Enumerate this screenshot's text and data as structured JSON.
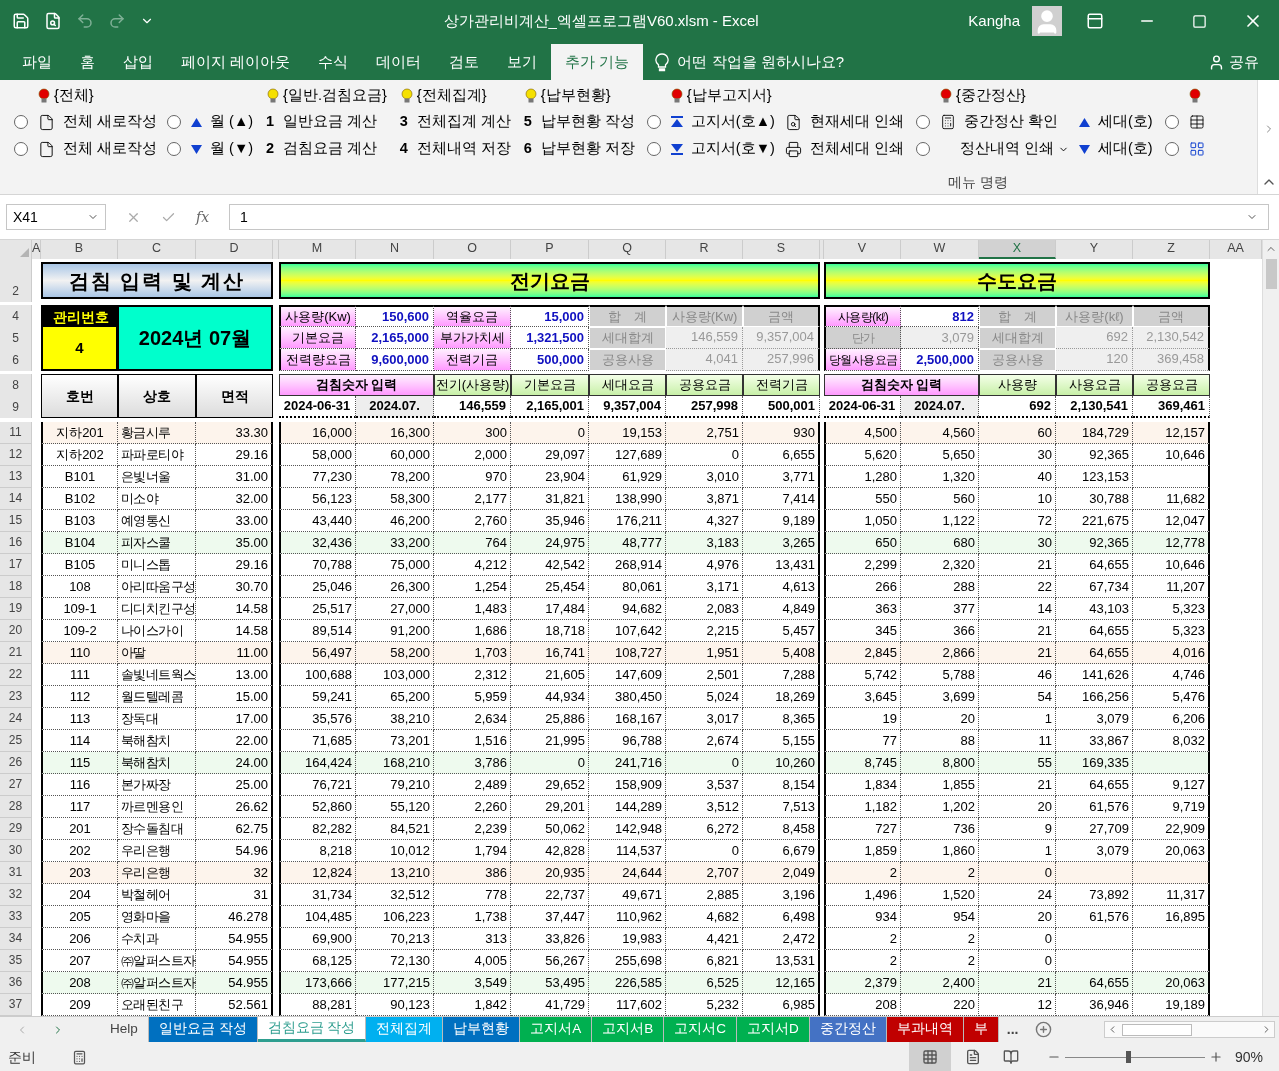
{
  "window": {
    "title": "상가관리비계산_엑셀프로그램V60.xlsm  -  Excel",
    "user": "Kangha"
  },
  "menu_tabs": [
    {
      "label": "파일",
      "selected": false
    },
    {
      "label": "홈",
      "selected": false
    },
    {
      "label": "삽입",
      "selected": false
    },
    {
      "label": "페이지 레이아웃",
      "selected": false
    },
    {
      "label": "수식",
      "selected": false
    },
    {
      "label": "데이터",
      "selected": false
    },
    {
      "label": "검토",
      "selected": false
    },
    {
      "label": "보기",
      "selected": false
    },
    {
      "label": "추가 기능",
      "selected": true
    }
  ],
  "tell_me": "어떤 작업을 원하시나요?",
  "share": "공유",
  "ribbon": {
    "group_label": "메뉴 명령",
    "sections": [
      {
        "header": {
          "label": "{전체}",
          "color": "#e00000"
        },
        "columns": [
          [
            {
              "kind": "radio",
              "selected": false
            },
            {
              "kind": "radio",
              "selected": false
            }
          ],
          [
            {
              "kind": "page",
              "text": "전체 새로작성"
            },
            {
              "kind": "page",
              "text": "전체 새로작성"
            }
          ],
          [
            {
              "kind": "radio",
              "selected": false
            },
            {
              "kind": "radio",
              "selected": false
            }
          ],
          [
            {
              "kind": "up",
              "text": "월 (▲)"
            },
            {
              "kind": "down",
              "text": "월 (▼)"
            }
          ]
        ]
      },
      {
        "header": {
          "label": "{일반.검침요금}",
          "color": "#f5e000"
        },
        "columns": [
          [
            {
              "kind": "number",
              "number": "1",
              "text": "일반요금 계산"
            },
            {
              "kind": "number",
              "number": "2",
              "text": "검침요금 계산"
            }
          ]
        ]
      },
      {
        "header": {
          "label": "{전체집계}",
          "color": "#f5e000"
        },
        "columns": [
          [
            {
              "kind": "number",
              "number": "3",
              "text": "전체집계 계산"
            },
            {
              "kind": "number",
              "number": "4",
              "text": "전체내역 저장"
            }
          ]
        ]
      },
      {
        "header": {
          "label": "{납부현황}",
          "color": "#f5e000"
        },
        "columns": [
          [
            {
              "kind": "number",
              "number": "5",
              "text": "납부현황 작성"
            },
            {
              "kind": "number",
              "number": "6",
              "text": "납부현황 저장"
            }
          ]
        ]
      },
      {
        "header": {
          "label": "{납부고지서}",
          "color": "#e00000"
        },
        "columns": [
          [
            {
              "kind": "radio",
              "selected": false
            },
            {
              "kind": "radio",
              "selected": false
            }
          ],
          [
            {
              "kind": "sortup",
              "text": "고지서(호▲)"
            },
            {
              "kind": "sortdown",
              "text": "고지서(호▼)"
            }
          ],
          [
            {
              "kind": "preview",
              "text": "현재세대 인쇄"
            },
            {
              "kind": "print",
              "text": "전체세대 인쇄"
            }
          ]
        ]
      },
      {
        "header": {
          "label": "{중간정산}",
          "color": "#e00000"
        },
        "columns": [
          [
            {
              "kind": "radio",
              "selected": false
            },
            {
              "kind": "radio",
              "selected": false
            }
          ],
          [
            {
              "kind": "calc",
              "text": "중간정산 확인"
            },
            {
              "kind": "menu",
              "text": "정산내역 인쇄"
            }
          ],
          [
            {
              "kind": "up",
              "text": "세대(호)"
            },
            {
              "kind": "down",
              "text": "세대(호)"
            }
          ]
        ]
      },
      {
        "header": {
          "color": "#e00000"
        },
        "columns": [
          [
            {
              "kind": "radio",
              "selected": false
            },
            {
              "kind": "radio",
              "selected": false
            }
          ],
          [
            {
              "kind": "table"
            },
            {
              "kind": "grid"
            }
          ]
        ]
      }
    ]
  },
  "formula_bar": {
    "name_box": "X41",
    "fx": "fx",
    "value": "1"
  },
  "sheet": {
    "column_headers": [
      {
        "label": "A",
        "selected": false
      },
      {
        "label": "B",
        "selected": false
      },
      {
        "label": "C",
        "selected": false
      },
      {
        "label": "D",
        "selected": false
      },
      {
        "label": "M",
        "selected": false
      },
      {
        "label": "N",
        "selected": false
      },
      {
        "label": "O",
        "selected": false
      },
      {
        "label": "P",
        "selected": false
      },
      {
        "label": "Q",
        "selected": false
      },
      {
        "label": "R",
        "selected": false
      },
      {
        "label": "S",
        "selected": false
      },
      {
        "label": "V",
        "selected": false
      },
      {
        "label": "W",
        "selected": false
      },
      {
        "label": "X",
        "selected": true
      },
      {
        "label": "Y",
        "selected": false
      },
      {
        "label": "Z",
        "selected": false
      },
      {
        "label": "AA",
        "selected": false
      }
    ],
    "header_rows": [
      "2",
      "4",
      "5",
      "6",
      "8",
      "9"
    ],
    "title": "검침 입력 및 계산",
    "electric_title": "전기요금",
    "water_title": "수도요금",
    "mgmt_label": "관리번호",
    "mgmt_no": "4",
    "period": "2024년 07월",
    "electric_inputs": [
      [
        {
          "label": "사용량(Kw)",
          "value": "150,600"
        },
        {
          "label": "역율요금",
          "value": "15,000"
        }
      ],
      [
        {
          "label": "기본요금",
          "value": "2,165,000"
        },
        {
          "label": "부가가치세",
          "value": "1,321,500"
        }
      ],
      [
        {
          "label": "전력량요금",
          "value": "9,600,000"
        },
        {
          "label": "전력기금",
          "value": "500,000"
        }
      ]
    ],
    "electric_summary": [
      [
        "합　계",
        "사용량(Kw)",
        "금액"
      ],
      [
        "세대합계",
        "146,559",
        "9,357,004"
      ],
      [
        "공용사용",
        "4,041",
        "257,996"
      ]
    ],
    "water_inputs": [
      {
        "kind": "input",
        "label": "사용량(kℓ)",
        "value": "812"
      },
      {
        "kind": "computed",
        "label": "단가",
        "value": "3,079"
      },
      {
        "kind": "input",
        "label": "당월사용요금",
        "value": "2,500,000"
      }
    ],
    "water_summary": [
      [
        "합　계",
        "사용량(kℓ)",
        "금액"
      ],
      [
        "세대합계",
        "692",
        "2,130,542"
      ],
      [
        "공용사용",
        "120",
        "369,458"
      ]
    ],
    "table_heads": [
      "호번",
      "상호",
      "면적"
    ],
    "electric_heads": [
      "검침숫자 입력",
      "전기(사용량)",
      "기본요금",
      "세대요금",
      "공용요금",
      "전력기금"
    ],
    "electric_totals": [
      "2024-06-31",
      "2024.07.",
      "146,559",
      "2,165,001",
      "9,357,004",
      "257,998",
      "500,001"
    ],
    "water_heads": [
      "검침숫자 입력",
      "사용량",
      "사용요금",
      "공용요금"
    ],
    "water_totals": [
      "2024-06-31",
      "2024.07.",
      "692",
      "2,130,541",
      "369,461"
    ],
    "rows": [
      {
        "row": "11",
        "color": "#fdf4ec",
        "cells": [
          "지하201",
          "황금시루",
          "33.30",
          "16,000",
          "16,300",
          "300",
          "0",
          "19,153",
          "2,751",
          "930",
          "4,500",
          "4,560",
          "60",
          "184,729",
          "12,157"
        ]
      },
      {
        "row": "12",
        "color": "#ffffff",
        "cells": [
          "지하202",
          "파파로티야",
          "29.16",
          "58,000",
          "60,000",
          "2,000",
          "29,097",
          "127,689",
          "0",
          "6,655",
          "5,620",
          "5,650",
          "30",
          "92,365",
          "10,646"
        ]
      },
      {
        "row": "13",
        "color": "#ffffff",
        "cells": [
          "B101",
          "은빛너울",
          "31.00",
          "77,230",
          "78,200",
          "970",
          "23,904",
          "61,929",
          "3,010",
          "3,771",
          "1,280",
          "1,320",
          "40",
          "123,153",
          null
        ]
      },
      {
        "row": "14",
        "color": "#ffffff",
        "cells": [
          "B102",
          "미소야",
          "32.00",
          "56,123",
          "58,300",
          "2,177",
          "31,821",
          "138,990",
          "3,871",
          "7,414",
          "550",
          "560",
          "10",
          "30,788",
          "11,682"
        ]
      },
      {
        "row": "15",
        "color": "#ffffff",
        "cells": [
          "B103",
          "예영통신",
          "33.00",
          "43,440",
          "46,200",
          "2,760",
          "35,946",
          "176,211",
          "4,327",
          "9,189",
          "1,050",
          "1,122",
          "72",
          "221,675",
          "12,047"
        ]
      },
      {
        "row": "16",
        "color": "#eefaee",
        "cells": [
          "B104",
          "피자스쿨",
          "35.00",
          "32,436",
          "33,200",
          "764",
          "24,975",
          "48,777",
          "3,183",
          "3,265",
          "650",
          "680",
          "30",
          "92,365",
          "12,778"
        ]
      },
      {
        "row": "17",
        "color": "#ffffff",
        "cells": [
          "B105",
          "미니스톱",
          "29.16",
          "70,788",
          "75,000",
          "4,212",
          "42,542",
          "268,914",
          "4,976",
          "13,431",
          "2,299",
          "2,320",
          "21",
          "64,655",
          "10,646"
        ]
      },
      {
        "row": "18",
        "color": "#ffffff",
        "cells": [
          "108",
          "아리따움구성",
          "30.70",
          "25,046",
          "26,300",
          "1,254",
          "25,454",
          "80,061",
          "3,171",
          "4,613",
          "266",
          "288",
          "22",
          "67,734",
          "11,207"
        ]
      },
      {
        "row": "19",
        "color": "#ffffff",
        "cells": [
          "109-1",
          "디디치킨구성",
          "14.58",
          "25,517",
          "27,000",
          "1,483",
          "17,484",
          "94,682",
          "2,083",
          "4,849",
          "363",
          "377",
          "14",
          "43,103",
          "5,323"
        ]
      },
      {
        "row": "20",
        "color": "#ffffff",
        "cells": [
          "109-2",
          "나이스가이",
          "14.58",
          "89,514",
          "91,200",
          "1,686",
          "18,718",
          "107,642",
          "2,215",
          "5,457",
          "345",
          "366",
          "21",
          "64,655",
          "5,323"
        ]
      },
      {
        "row": "21",
        "color": "#fdf4ec",
        "cells": [
          "110",
          "아딸",
          "11.00",
          "56,497",
          "58,200",
          "1,703",
          "16,741",
          "108,727",
          "1,951",
          "5,408",
          "2,845",
          "2,866",
          "21",
          "64,655",
          "4,016"
        ]
      },
      {
        "row": "22",
        "color": "#ffffff",
        "cells": [
          "111",
          "솔빛네트웍스",
          "13.00",
          "100,688",
          "103,000",
          "2,312",
          "21,605",
          "147,609",
          "2,501",
          "7,288",
          "5,742",
          "5,788",
          "46",
          "141,626",
          "4,746"
        ]
      },
      {
        "row": "23",
        "color": "#ffffff",
        "cells": [
          "112",
          "월드텔레콤",
          "15.00",
          "59,241",
          "65,200",
          "5,959",
          "44,934",
          "380,450",
          "5,024",
          "18,269",
          "3,645",
          "3,699",
          "54",
          "166,256",
          "5,476"
        ]
      },
      {
        "row": "24",
        "color": "#ffffff",
        "cells": [
          "113",
          "장독대",
          "17.00",
          "35,576",
          "38,210",
          "2,634",
          "25,886",
          "168,167",
          "3,017",
          "8,365",
          "19",
          "20",
          "1",
          "3,079",
          "6,206"
        ]
      },
      {
        "row": "25",
        "color": "#ffffff",
        "cells": [
          "114",
          "북해참치",
          "22.00",
          "71,685",
          "73,201",
          "1,516",
          "21,995",
          "96,788",
          "2,674",
          "5,155",
          "77",
          "88",
          "11",
          "33,867",
          "8,032"
        ]
      },
      {
        "row": "26",
        "color": "#eefaee",
        "cells": [
          "115",
          "북해참치",
          "24.00",
          "164,424",
          "168,210",
          "3,786",
          "0",
          "241,716",
          "0",
          "10,260",
          "8,745",
          "8,800",
          "55",
          "169,335",
          null
        ]
      },
      {
        "row": "27",
        "color": "#ffffff",
        "cells": [
          "116",
          "본가짜장",
          "25.00",
          "76,721",
          "79,210",
          "2,489",
          "29,652",
          "158,909",
          "3,537",
          "8,154",
          "1,834",
          "1,855",
          "21",
          "64,655",
          "9,127"
        ]
      },
      {
        "row": "28",
        "color": "#ffffff",
        "cells": [
          "117",
          "까르멘용인",
          "26.62",
          "52,860",
          "55,120",
          "2,260",
          "29,201",
          "144,289",
          "3,512",
          "7,513",
          "1,182",
          "1,202",
          "20",
          "61,576",
          "9,719"
        ]
      },
      {
        "row": "29",
        "color": "#ffffff",
        "cells": [
          "201",
          "장수돌침대",
          "62.75",
          "82,282",
          "84,521",
          "2,239",
          "50,062",
          "142,948",
          "6,272",
          "8,458",
          "727",
          "736",
          "9",
          "27,709",
          "22,909"
        ]
      },
      {
        "row": "30",
        "color": "#ffffff",
        "cells": [
          "202",
          "우리은행",
          "54.96",
          "8,218",
          "10,012",
          "1,794",
          "42,828",
          "114,537",
          "0",
          "6,679",
          "1,859",
          "1,860",
          "1",
          "3,079",
          "20,063"
        ]
      },
      {
        "row": "31",
        "color": "#fdf4ec",
        "cells": [
          "203",
          "우리은행",
          "32",
          "12,824",
          "13,210",
          "386",
          "20,935",
          "24,644",
          "2,707",
          "2,049",
          "2",
          "2",
          "0",
          null,
          null
        ]
      },
      {
        "row": "32",
        "color": "#ffffff",
        "cells": [
          "204",
          "박철헤어",
          "31",
          "31,734",
          "32,512",
          "778",
          "22,737",
          "49,671",
          "2,885",
          "3,196",
          "1,496",
          "1,520",
          "24",
          "73,892",
          "11,317"
        ]
      },
      {
        "row": "33",
        "color": "#ffffff",
        "cells": [
          "205",
          "영화마을",
          "46.278",
          "104,485",
          "106,223",
          "1,738",
          "37,447",
          "110,962",
          "4,682",
          "6,498",
          "934",
          "954",
          "20",
          "61,576",
          "16,895"
        ]
      },
      {
        "row": "34",
        "color": "#ffffff",
        "cells": [
          "206",
          "수치과",
          "54.955",
          "69,900",
          "70,213",
          "313",
          "33,826",
          "19,983",
          "4,421",
          "2,472",
          "2",
          "2",
          "0",
          null,
          null
        ]
      },
      {
        "row": "35",
        "color": "#ffffff",
        "cells": [
          "207",
          "㈜알퍼스트자",
          "54.955",
          "68,125",
          "72,130",
          "4,005",
          "56,267",
          "255,698",
          "6,821",
          "13,531",
          "2",
          "2",
          "0",
          null,
          null
        ]
      },
      {
        "row": "36",
        "color": "#eefaee",
        "cells": [
          "208",
          "㈜알퍼스트자",
          "54.955",
          "173,666",
          "177,215",
          "3,549",
          "53,495",
          "226,585",
          "6,525",
          "12,165",
          "2,379",
          "2,400",
          "21",
          "64,655",
          "20,063"
        ]
      },
      {
        "row": "37",
        "color": "#ffffff",
        "cells": [
          "209",
          "오래된친구",
          "52.561",
          "88,281",
          "90,123",
          "1,842",
          "41,729",
          "117,602",
          "5,232",
          "6,985",
          "208",
          "220",
          "12",
          "36,946",
          "19,189"
        ]
      }
    ]
  },
  "sheet_tabs": [
    {
      "label": "Help",
      "selected": false
    },
    {
      "label": "일반요금 작성",
      "color": "#0070c0",
      "selected": false
    },
    {
      "label": "검침요금 작성",
      "color": "#2e9e8f",
      "selected": true
    },
    {
      "label": "전체집계",
      "color": "#00b0f0",
      "selected": false
    },
    {
      "label": "납부현황",
      "color": "#0070c0",
      "selected": false
    },
    {
      "label": "고지서A",
      "color": "#00b050",
      "selected": false
    },
    {
      "label": "고지서B",
      "color": "#00b050",
      "selected": false
    },
    {
      "label": "고지서C",
      "color": "#00b050",
      "selected": false
    },
    {
      "label": "고지서D",
      "color": "#00b050",
      "selected": false
    },
    {
      "label": "중간정산",
      "color": "#4472c4",
      "selected": false
    },
    {
      "label": "부과내역",
      "color": "#c00000",
      "selected": false
    },
    {
      "label": "부",
      "color": "#c00000",
      "selected": false
    }
  ],
  "tabs_more": "...",
  "status_bar": {
    "text": "준비",
    "zoom": "90%",
    "level": 0.45
  }
}
